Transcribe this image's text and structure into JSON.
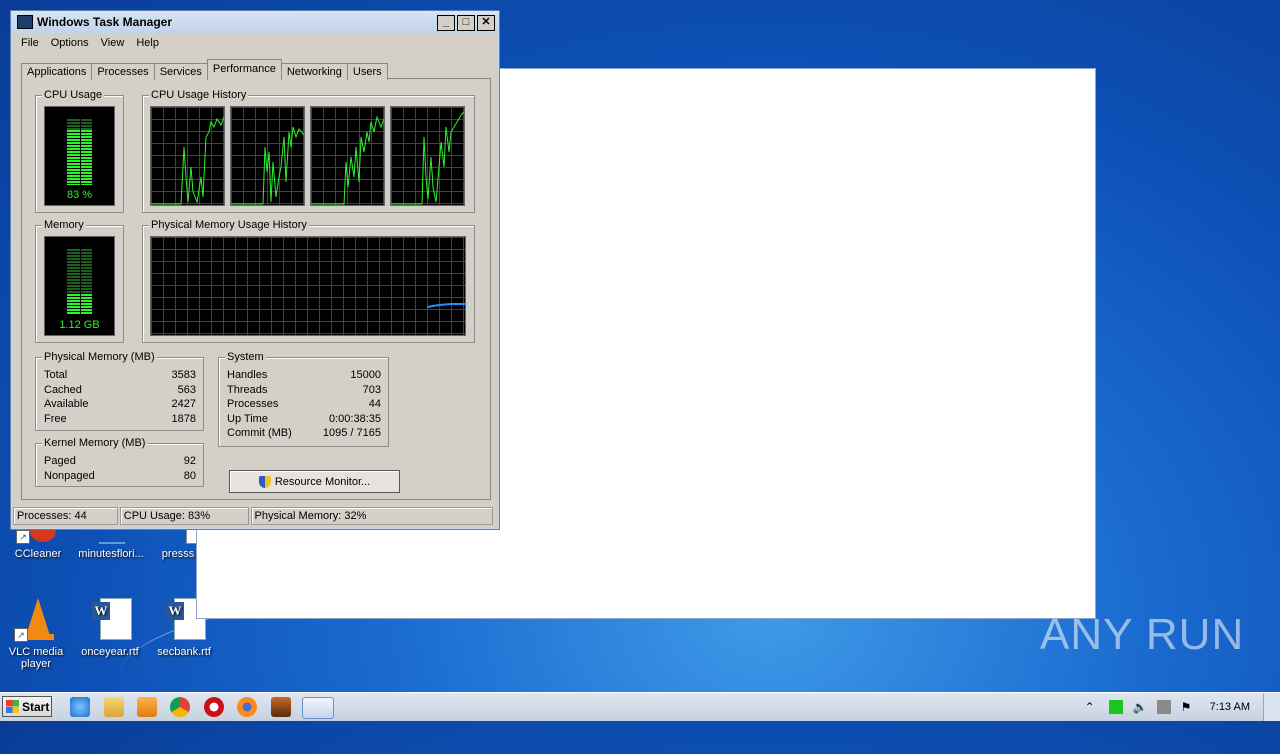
{
  "window": {
    "title": "Windows Task Manager",
    "menu": [
      "File",
      "Options",
      "View",
      "Help"
    ],
    "tabs": [
      "Applications",
      "Processes",
      "Services",
      "Performance",
      "Networking",
      "Users"
    ],
    "active_tab": "Performance"
  },
  "performance": {
    "cpu_usage_label": "CPU Usage",
    "cpu_usage_value": "83 %",
    "cpu_usage_level": 0.83,
    "cpu_history_label": "CPU Usage History",
    "memory_label": "Memory",
    "memory_value": "1.12 GB",
    "memory_level": 0.32,
    "memory_history_label": "Physical Memory Usage History",
    "physical_memory": {
      "title": "Physical Memory (MB)",
      "rows": [
        {
          "label": "Total",
          "value": "3583"
        },
        {
          "label": "Cached",
          "value": "563"
        },
        {
          "label": "Available",
          "value": "2427"
        },
        {
          "label": "Free",
          "value": "1878"
        }
      ]
    },
    "kernel_memory": {
      "title": "Kernel Memory (MB)",
      "rows": [
        {
          "label": "Paged",
          "value": "92"
        },
        {
          "label": "Nonpaged",
          "value": "80"
        }
      ]
    },
    "system": {
      "title": "System",
      "rows": [
        {
          "label": "Handles",
          "value": "15000"
        },
        {
          "label": "Threads",
          "value": "703"
        },
        {
          "label": "Processes",
          "value": "44"
        },
        {
          "label": "Up Time",
          "value": "0:00:38:35"
        },
        {
          "label": "Commit (MB)",
          "value": "1095 / 7165"
        }
      ]
    },
    "resource_monitor_button": "Resource Monitor..."
  },
  "status_bar": {
    "processes": "Processes: 44",
    "cpu": "CPU Usage: 83%",
    "memory": "Physical Memory: 32%"
  },
  "desktop_icons": [
    {
      "label": "CCleaner"
    },
    {
      "label": "minutesflori..."
    },
    {
      "label": "presss"
    },
    {
      "label": "VLC media player"
    },
    {
      "label": "onceyear.rtf"
    },
    {
      "label": "secbank.rtf"
    }
  ],
  "taskbar": {
    "start_label": "Start",
    "clock": "7:13 AM"
  },
  "watermark": "ANY RUN",
  "colors": {
    "graph_green": "#2ef22e",
    "graph_grid": "#006633",
    "memory_line": "#1e90ff"
  }
}
